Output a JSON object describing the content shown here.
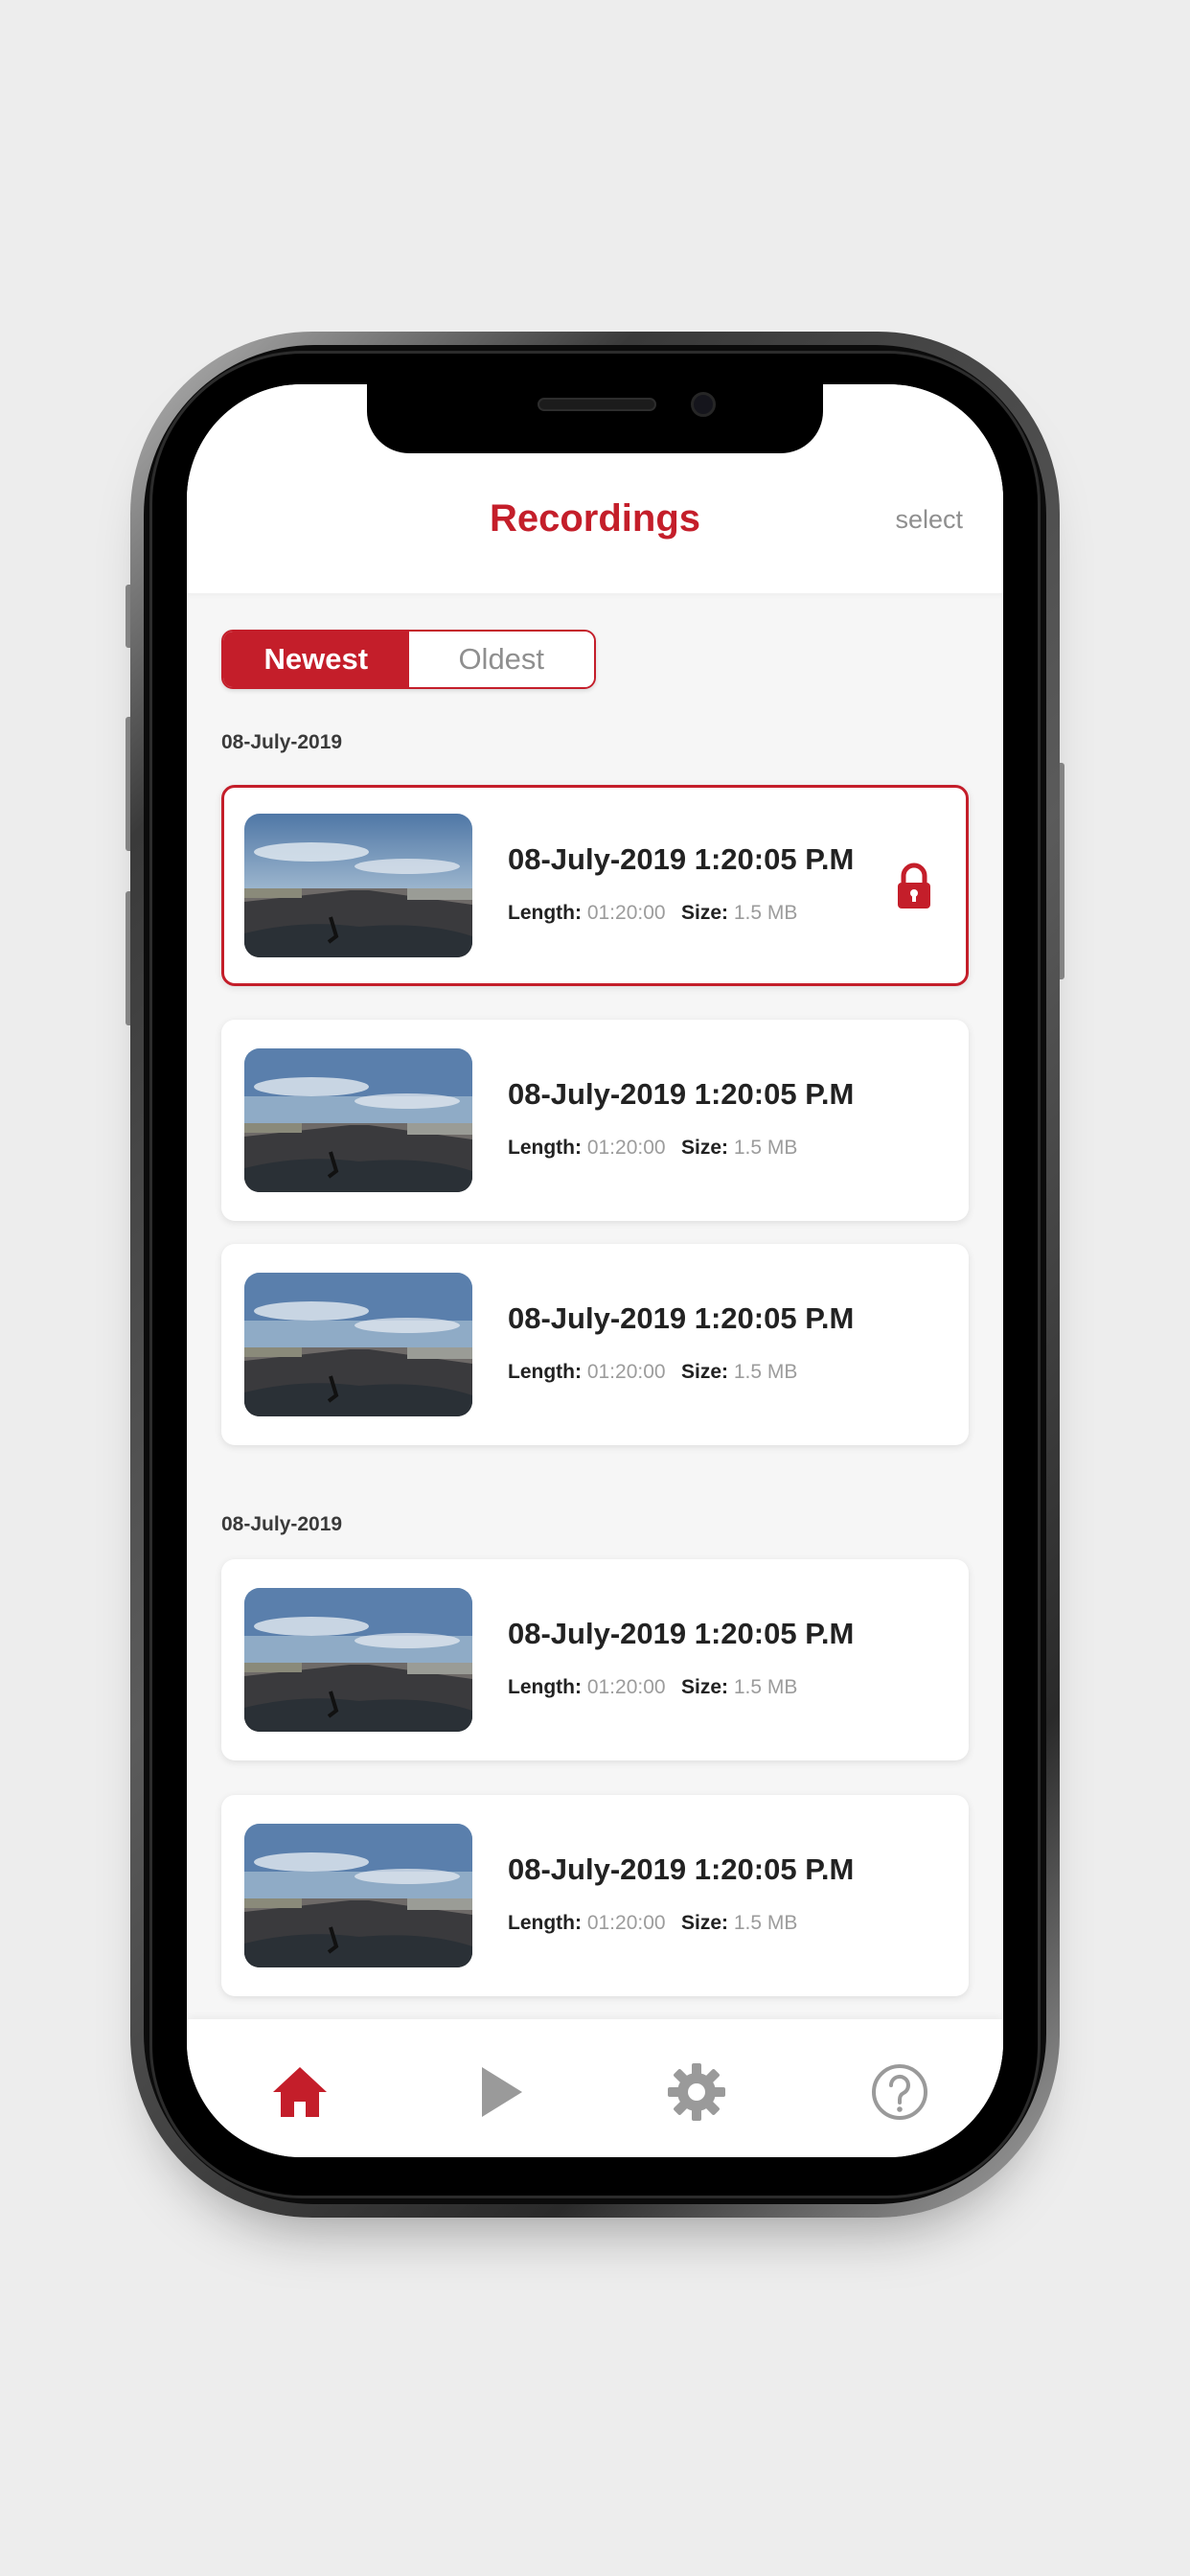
{
  "header": {
    "title": "Recordings",
    "select_label": "select"
  },
  "sort": {
    "options": [
      "Newest",
      "Oldest"
    ],
    "selected": "Newest"
  },
  "groups": [
    {
      "date": "08-July-2019",
      "items": [
        {
          "title": "08-July-2019 1:20:05 P.M",
          "length_label": "Length:",
          "length": "01:20:00",
          "size_label": "Size:",
          "size": "1.5 MB",
          "locked": true,
          "selected": true
        },
        {
          "title": "08-July-2019 1:20:05 P.M",
          "length_label": "Length:",
          "length": "01:20:00",
          "size_label": "Size:",
          "size": "1.5 MB",
          "locked": false,
          "selected": false
        },
        {
          "title": "08-July-2019 1:20:05 P.M",
          "length_label": "Length:",
          "length": "01:20:00",
          "size_label": "Size:",
          "size": "1.5 MB",
          "locked": false,
          "selected": false
        }
      ]
    },
    {
      "date": "08-July-2019",
      "items": [
        {
          "title": "08-July-2019 1:20:05 P.M",
          "length_label": "Length:",
          "length": "01:20:00",
          "size_label": "Size:",
          "size": "1.5 MB",
          "locked": false,
          "selected": false
        },
        {
          "title": "08-July-2019 1:20:05 P.M",
          "length_label": "Length:",
          "length": "01:20:00",
          "size_label": "Size:",
          "size": "1.5 MB",
          "locked": false,
          "selected": false
        }
      ]
    }
  ],
  "tabbar": [
    {
      "icon": "home-icon",
      "active": true
    },
    {
      "icon": "play-icon",
      "active": false
    },
    {
      "icon": "gear-icon",
      "active": false
    },
    {
      "icon": "help-icon",
      "active": false
    }
  ],
  "colors": {
    "accent": "#c41e2a",
    "muted": "#8f8f8f",
    "background": "#f6f6f6"
  }
}
